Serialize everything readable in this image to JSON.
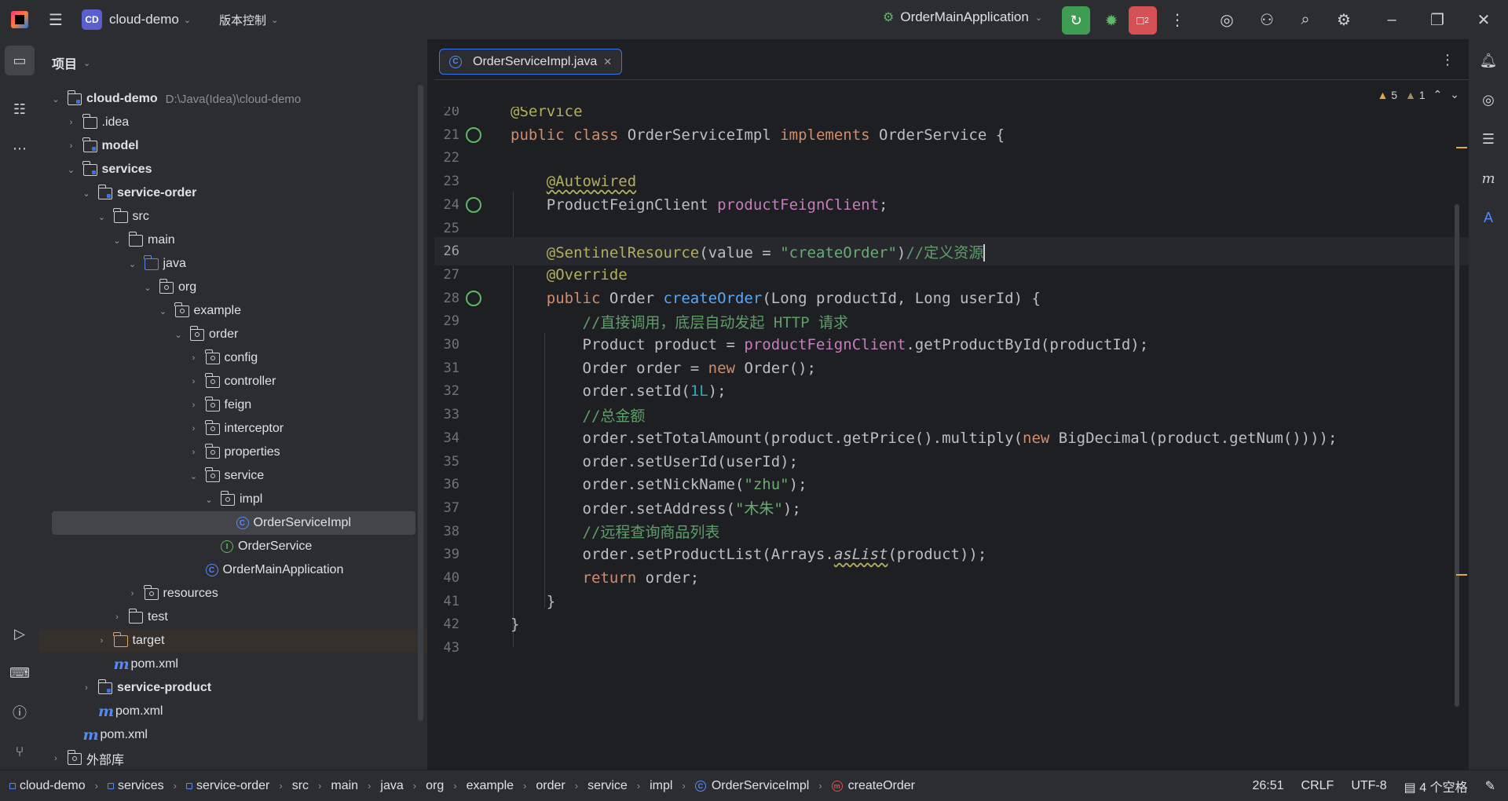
{
  "titlebar": {
    "project_badge": "CD",
    "project_name": "cloud-demo",
    "vcs": "版本控制",
    "run_config": "OrderMainApplication",
    "stop_count": "2"
  },
  "project_panel": {
    "title": "项目",
    "tree": [
      {
        "label": "cloud-demo",
        "hint": "D:\\Java(Idea)\\cloud-demo",
        "depth": 0,
        "expanded": true,
        "icon": "module-folder-icon",
        "bold": true
      },
      {
        "label": ".idea",
        "depth": 1,
        "expanded": false,
        "icon": "folder-icon"
      },
      {
        "label": "model",
        "depth": 1,
        "expanded": false,
        "icon": "module-folder-icon",
        "bold": true
      },
      {
        "label": "services",
        "depth": 1,
        "expanded": true,
        "icon": "module-folder-icon",
        "bold": true
      },
      {
        "label": "service-order",
        "depth": 2,
        "expanded": true,
        "icon": "module-folder-icon",
        "bold": true
      },
      {
        "label": "src",
        "depth": 3,
        "expanded": true,
        "icon": "folder-icon"
      },
      {
        "label": "main",
        "depth": 4,
        "expanded": true,
        "icon": "folder-icon"
      },
      {
        "label": "java",
        "depth": 5,
        "expanded": true,
        "icon": "source-folder-icon"
      },
      {
        "label": "org",
        "depth": 6,
        "expanded": true,
        "icon": "package-icon"
      },
      {
        "label": "example",
        "depth": 7,
        "expanded": true,
        "icon": "package-icon"
      },
      {
        "label": "order",
        "depth": 8,
        "expanded": true,
        "icon": "package-icon"
      },
      {
        "label": "config",
        "depth": 9,
        "expanded": false,
        "icon": "package-icon"
      },
      {
        "label": "controller",
        "depth": 9,
        "expanded": false,
        "icon": "package-icon"
      },
      {
        "label": "feign",
        "depth": 9,
        "expanded": false,
        "icon": "package-icon"
      },
      {
        "label": "interceptor",
        "depth": 9,
        "expanded": false,
        "icon": "package-icon"
      },
      {
        "label": "properties",
        "depth": 9,
        "expanded": false,
        "icon": "package-icon"
      },
      {
        "label": "service",
        "depth": 9,
        "expanded": true,
        "icon": "package-icon"
      },
      {
        "label": "impl",
        "depth": 10,
        "expanded": true,
        "icon": "package-icon"
      },
      {
        "label": "OrderServiceImpl",
        "depth": 11,
        "icon": "class-icon",
        "selected": true
      },
      {
        "label": "OrderService",
        "depth": 10,
        "icon": "interface-icon"
      },
      {
        "label": "OrderMainApplication",
        "depth": 9,
        "icon": "spring-boot-class-icon"
      },
      {
        "label": "resources",
        "depth": 5,
        "expanded": false,
        "icon": "resources-folder-icon"
      },
      {
        "label": "test",
        "depth": 4,
        "expanded": false,
        "icon": "folder-icon"
      },
      {
        "label": "target",
        "depth": 3,
        "expanded": false,
        "icon": "target-folder-icon",
        "ignored": true
      },
      {
        "label": "pom.xml",
        "depth": 3,
        "icon": "maven-icon"
      },
      {
        "label": "service-product",
        "depth": 2,
        "expanded": false,
        "icon": "module-folder-icon",
        "bold": true
      },
      {
        "label": "pom.xml",
        "depth": 2,
        "icon": "maven-icon"
      },
      {
        "label": "pom.xml",
        "depth": 1,
        "icon": "maven-icon"
      },
      {
        "label": "外部库",
        "depth": 0,
        "expanded": false,
        "icon": "library-icon"
      }
    ]
  },
  "editor": {
    "tab_label": "OrderServiceImpl.java",
    "warnings": "5",
    "weak_warnings": "1",
    "lines": [
      {
        "n": "20",
        "code": "@Service"
      },
      {
        "n": "21",
        "code": "public class OrderServiceImpl implements OrderService {"
      },
      {
        "n": "22",
        "code": ""
      },
      {
        "n": "23",
        "code": "    @Autowired"
      },
      {
        "n": "24",
        "code": "    ProductFeignClient productFeignClient;"
      },
      {
        "n": "25",
        "code": ""
      },
      {
        "n": "26",
        "code": "    @SentinelResource(value = \"createOrder\")//定义资源"
      },
      {
        "n": "27",
        "code": "    @Override"
      },
      {
        "n": "28",
        "code": "    public Order createOrder(Long productId, Long userId) {"
      },
      {
        "n": "29",
        "code": "        //直接调用，底层自动发起 HTTP 请求"
      },
      {
        "n": "30",
        "code": "        Product product = productFeignClient.getProductById(productId);"
      },
      {
        "n": "31",
        "code": "        Order order = new Order();"
      },
      {
        "n": "32",
        "code": "        order.setId(1L);"
      },
      {
        "n": "33",
        "code": "        //总金额"
      },
      {
        "n": "34",
        "code": "        order.setTotalAmount(product.getPrice().multiply(new BigDecimal(product.getNum())));"
      },
      {
        "n": "35",
        "code": "        order.setUserId(userId);"
      },
      {
        "n": "36",
        "code": "        order.setNickName(\"zhu\");"
      },
      {
        "n": "37",
        "code": "        order.setAddress(\"木朱\");"
      },
      {
        "n": "38",
        "code": "        //远程查询商品列表"
      },
      {
        "n": "39",
        "code": "        order.setProductList(Arrays.asList(product));"
      },
      {
        "n": "40",
        "code": "        return order;"
      },
      {
        "n": "41",
        "code": "    }"
      },
      {
        "n": "42",
        "code": "}"
      },
      {
        "n": "43",
        "code": ""
      }
    ]
  },
  "statusbar": {
    "breadcrumbs": [
      "cloud-demo",
      "services",
      "service-order",
      "src",
      "main",
      "java",
      "org",
      "example",
      "order",
      "service",
      "impl",
      "OrderServiceImpl",
      "createOrder"
    ],
    "position": "26:51",
    "line_sep": "CRLF",
    "encoding": "UTF-8",
    "indent": "4 个空格"
  }
}
